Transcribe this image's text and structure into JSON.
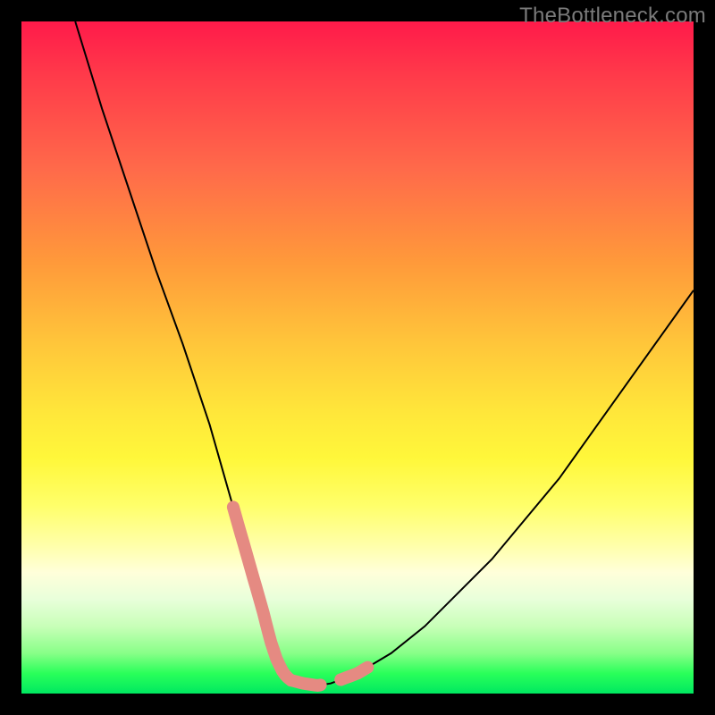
{
  "attribution": "TheBottleneck.com",
  "chart_data": {
    "type": "line",
    "title": "",
    "xlabel": "",
    "ylabel": "",
    "xlim": [
      0,
      100
    ],
    "ylim": [
      0,
      100
    ],
    "series": [
      {
        "name": "curve",
        "x": [
          8,
          12,
          16,
          20,
          24,
          28,
          30,
          32,
          34,
          36,
          37,
          38,
          39,
          40,
          42,
          44,
          46,
          50,
          55,
          60,
          65,
          70,
          75,
          80,
          85,
          90,
          95,
          100
        ],
        "values": [
          100,
          87,
          75,
          63,
          52,
          40,
          33,
          26,
          19,
          12,
          8,
          5,
          3,
          2,
          1.5,
          1.2,
          1.5,
          3,
          6,
          10,
          15,
          20,
          26,
          32,
          39,
          46,
          53,
          60
        ]
      }
    ],
    "highlights": [
      {
        "name": "left-descent-marks",
        "x_range": [
          31.5,
          37.5
        ],
        "stroke_width": 14
      },
      {
        "name": "flat-bottom-marks",
        "x_range": [
          37.5,
          44.5
        ],
        "stroke_width": 14
      },
      {
        "name": "right-ascent-marks",
        "x_range": [
          47.5,
          51.5
        ],
        "stroke_width": 14
      }
    ],
    "colors": {
      "curve_stroke": "#000000",
      "highlight_stroke": "#e58a82"
    }
  }
}
